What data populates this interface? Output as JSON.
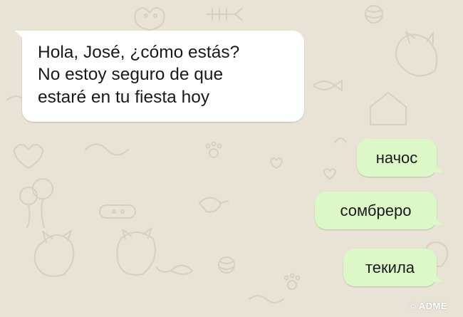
{
  "chat": {
    "wallpaper": "whatsapp-doodle-cats",
    "background_color": "#e9e3d6",
    "incoming_color": "#ffffff",
    "outgoing_color": "#dcf8c6"
  },
  "messages": [
    {
      "direction": "incoming",
      "text": "Hola, José, ¿cómo estás?\nNo estoy seguro de que\nestaré en tu fiesta hoy"
    },
    {
      "direction": "outgoing",
      "text": "начос"
    },
    {
      "direction": "outgoing",
      "text": "сомбреро"
    },
    {
      "direction": "outgoing",
      "text": "текила"
    }
  ],
  "watermark": "© ADME"
}
